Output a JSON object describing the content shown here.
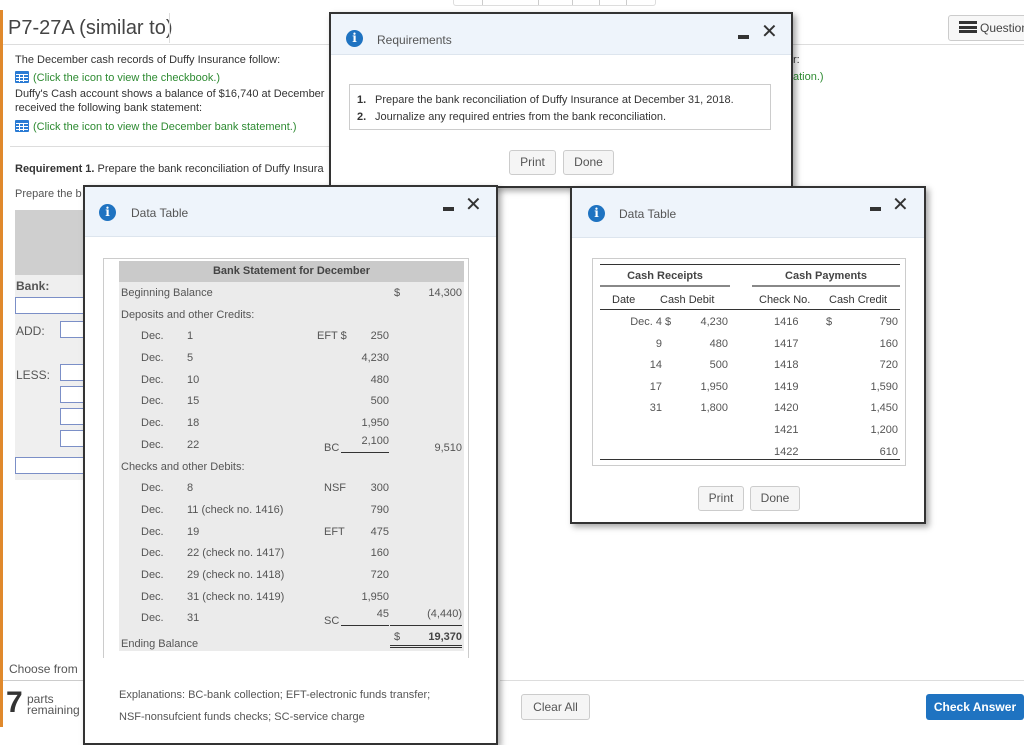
{
  "problem": {
    "title": "P7-27A (similar to)",
    "question_button": "Question"
  },
  "intro": {
    "line1": "The December cash records of Duffy Insurance follow:",
    "checkbook_link": "(Click the icon to view the checkbook.)",
    "line2": "Duffy's Cash account shows a balance of $16,740 at December",
    "line3": "received the following bank statement:",
    "statement_link": "(Click the icon to view the December bank statement.)",
    "partial_right_1": "r:",
    "partial_right_2": "ation.)"
  },
  "requirement": {
    "label": "Requirement 1.",
    "text": " Prepare the bank reconciliation of Duffy Insura",
    "prepare_partial": "Prepare the b"
  },
  "reconciliation": {
    "bank_label": "Bank:",
    "add_label": "ADD:",
    "less_label": "LESS:"
  },
  "footer": {
    "choose_from": "Choose from",
    "parts_count": "7",
    "parts_label_1": "parts",
    "parts_label_2": "remaining",
    "clear_all": "Clear All",
    "check_answer": "Check Answer"
  },
  "requirements_modal": {
    "title": "Requirements",
    "items": [
      {
        "num": "1.",
        "text": "Prepare the bank reconciliation of Duffy Insurance at December 31, 2018."
      },
      {
        "num": "2.",
        "text": "Journalize any required entries from the bank reconciliation."
      }
    ],
    "print": "Print",
    "done": "Done"
  },
  "bank_statement_modal": {
    "title": "Data Table",
    "table_title": "Bank Statement for December",
    "beginning_label": "Beginning Balance",
    "beginning_dollar": "$",
    "beginning_value": "14,300",
    "deposits_label": "Deposits and other Credits:",
    "deposits": [
      {
        "month": "Dec.",
        "day": "1",
        "code": "EFT $",
        "amount": "250",
        "total": ""
      },
      {
        "month": "Dec.",
        "day": "5",
        "code": "",
        "amount": "4,230",
        "total": ""
      },
      {
        "month": "Dec.",
        "day": "10",
        "code": "",
        "amount": "480",
        "total": ""
      },
      {
        "month": "Dec.",
        "day": "15",
        "code": "",
        "amount": "500",
        "total": ""
      },
      {
        "month": "Dec.",
        "day": "18",
        "code": "",
        "amount": "1,950",
        "total": ""
      },
      {
        "month": "Dec.",
        "day": "22",
        "code": "BC",
        "amount": "2,100",
        "total": "9,510"
      }
    ],
    "checks_label": "Checks and other Debits:",
    "checks": [
      {
        "month": "Dec.",
        "day": "8",
        "code": "NSF",
        "amount": "300",
        "total": ""
      },
      {
        "month": "Dec.",
        "day": "11 (check no. 1416)",
        "code": "",
        "amount": "790",
        "total": ""
      },
      {
        "month": "Dec.",
        "day": "19",
        "code": "EFT",
        "amount": "475",
        "total": ""
      },
      {
        "month": "Dec.",
        "day": "22 (check no. 1417)",
        "code": "",
        "amount": "160",
        "total": ""
      },
      {
        "month": "Dec.",
        "day": "29 (check no. 1418)",
        "code": "",
        "amount": "720",
        "total": ""
      },
      {
        "month": "Dec.",
        "day": "31 (check no. 1419)",
        "code": "",
        "amount": "1,950",
        "total": ""
      },
      {
        "month": "Dec.",
        "day": "31",
        "code": "SC",
        "amount": "45",
        "total": "(4,440)"
      }
    ],
    "ending_label": "Ending Balance",
    "ending_dollar": "$",
    "ending_value": "19,370",
    "explanation_1": "Explanations: BC-bank collection; EFT-electronic funds transfer;",
    "explanation_2": "NSF-nonsufcient funds checks; SC-service charge"
  },
  "checkbook_modal": {
    "title": "Data Table",
    "receipts_header": "Cash Receipts",
    "payments_header": "Cash Payments",
    "col_date": "Date",
    "col_cash_debit": "Cash Debit",
    "col_check_no": "Check No.",
    "col_cash_credit": "Cash Credit",
    "receipts": [
      {
        "date": "Dec. 4",
        "dollar": "$",
        "amount": "4,230"
      },
      {
        "date": "9",
        "dollar": "",
        "amount": "480"
      },
      {
        "date": "14",
        "dollar": "",
        "amount": "500"
      },
      {
        "date": "17",
        "dollar": "",
        "amount": "1,950"
      },
      {
        "date": "31",
        "dollar": "",
        "amount": "1,800"
      }
    ],
    "payments": [
      {
        "check_no": "1416",
        "dollar": "$",
        "amount": "790"
      },
      {
        "check_no": "1417",
        "dollar": "",
        "amount": "160"
      },
      {
        "check_no": "1418",
        "dollar": "",
        "amount": "720"
      },
      {
        "check_no": "1419",
        "dollar": "",
        "amount": "1,590"
      },
      {
        "check_no": "1420",
        "dollar": "",
        "amount": "1,450"
      },
      {
        "check_no": "1421",
        "dollar": "",
        "amount": "1,200"
      },
      {
        "check_no": "1422",
        "dollar": "",
        "amount": "610"
      }
    ],
    "print": "Print",
    "done": "Done"
  },
  "icons": {
    "info": "i",
    "close": "✕"
  }
}
